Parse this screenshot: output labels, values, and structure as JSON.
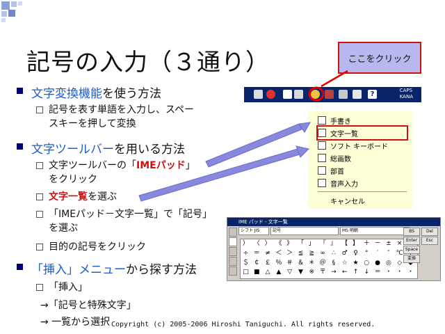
{
  "title": "記号の入力（３通り）",
  "callout": "ここをクリック",
  "bullets": [
    {
      "pre": "",
      "hl": "文字変換機能",
      "post": "を使う方法"
    },
    {
      "pre": "",
      "hl": "文字ツールバー",
      "post": "を用いる方法"
    },
    {
      "pre": "",
      "hl": "「挿入」メニュー",
      "post": "から探す方法"
    }
  ],
  "subs": {
    "s1_l1": "記号を表す単語を入力し、スペー",
    "s1_l2": "スキーを押して変換",
    "s2_l1_pre": "文字ツールバーの「",
    "s2_l1_red": "IMEパッド",
    "s2_l1_post": "」",
    "s2_l2": "をクリック",
    "s3_red": "文字一覧",
    "s3_post": "を選ぶ",
    "s4_l1": "「IMEパッド－文字一覧」で「記号」",
    "s4_l2": "を選ぶ",
    "s5": "目的の記号をクリック",
    "s6": "「挿入」",
    "p1": "→「記号と特殊文字」",
    "p2": "→ 一覧から選択"
  },
  "toolbar": {
    "caps": "CAPS",
    "kana": "KANA"
  },
  "menu": {
    "items": [
      "手書き",
      "文字一覧",
      "ソフト キーボード",
      "総画数",
      "部首",
      "音声入力",
      "キャンセル"
    ]
  },
  "imepad": {
    "title": "IME パッド - 文字一覧",
    "font_select": "MS 明朝",
    "category": "記号",
    "shift": "シフト JIS",
    "buttons": [
      "BS",
      "Del",
      "Enter",
      "Esc",
      "Space",
      "変換"
    ],
    "rows": [
      [
        "）",
        "〈",
        "〉",
        "《",
        "》",
        "「",
        "」",
        "『",
        "』",
        "【",
        "】",
        "＋",
        "－",
        "±",
        "×"
      ],
      [
        "÷",
        "＝",
        "≠",
        "＜",
        "＞",
        "≦",
        "≧",
        "∞",
        "∴",
        "♂",
        "♀",
        "°",
        "′",
        "″",
        "℃",
        "￥"
      ],
      [
        "＄",
        "￠",
        "￡",
        "％",
        "＃",
        "＆",
        "＊",
        "＠",
        "§",
        "☆",
        "★",
        "○",
        "●",
        "◎",
        "◇",
        "◆"
      ],
      [
        "□",
        "■",
        "△",
        "▲",
        "▽",
        "▼",
        "※",
        "〒",
        "→",
        "←",
        "↑",
        "↓",
        "＝",
        "・",
        "・",
        "・"
      ]
    ]
  },
  "footer": "Copyright (c) 2005-2006 Hiroshi Taniguchi. All rights reserved."
}
